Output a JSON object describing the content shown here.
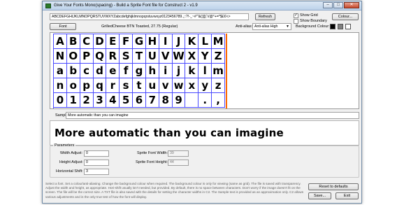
{
  "window": {
    "title": "Give Your Fonts Mono(spacing) - Build a Sprite Font file for Construct 2 - v1.9",
    "buttons": [
      "–",
      "□",
      "✕"
    ]
  },
  "toolbar": {
    "characters_value": "ABCDEFGHIJKLMNOPQRSTUVWXYZabcdefghijklmnopqrstuvwxyz0123456789.,;:?!-_~#\"'&()[]|`\\/@°+=*$£€<>",
    "refresh_label": "Refresh",
    "show_grid_label": "Show Grid",
    "show_grid_checked": "✓",
    "show_boundary_label": "Show Boundary",
    "show_boundary_checked": "",
    "colour_button_label": "Colour...",
    "font_button_label": "Font",
    "font_info": "GrilledCheese BTN Toasted, 27.75 (Regular)",
    "anti_alias_label": "Anti-alias:",
    "anti_alias_value": "Anti-alias High",
    "background_colour_label": "Background Colour:"
  },
  "glyph_rows": [
    [
      "A",
      "B",
      "C",
      "D",
      "E",
      "F",
      "G",
      "H",
      "I",
      "J",
      "K",
      "L",
      "M"
    ],
    [
      "N",
      "O",
      "P",
      "Q",
      "R",
      "S",
      "T",
      "U",
      "V",
      "W",
      "X",
      "Y",
      "Z"
    ],
    [
      "a",
      "b",
      "c",
      "d",
      "e",
      "f",
      "g",
      "h",
      "i",
      "j",
      "k",
      "l",
      "m"
    ],
    [
      "n",
      "o",
      "p",
      "q",
      "r",
      "s",
      "t",
      "u",
      "v",
      "w",
      "x",
      "y",
      "z"
    ],
    [
      "0",
      "1",
      "2",
      "3",
      "4",
      "5",
      "6",
      "7",
      "8",
      "9",
      "",
      ".",
      ","
    ]
  ],
  "sample": {
    "label": "Sample:",
    "input_value": "More automatic than you can imagine",
    "preview_text": "More automatic than you can imagine"
  },
  "params": {
    "legend": "Parameters",
    "width_adjust_label": "Width Adjust:",
    "width_adjust_value": "0",
    "height_adjust_label": "Height Adjust:",
    "height_adjust_value": "0",
    "horizontal_shift_label": "Horizontal Shift:",
    "horizontal_shift_value": "3",
    "sprite_font_width_label": "Sprite Font Width:",
    "sprite_font_width_value": "39",
    "sprite_font_height_label": "Sprite Font Height:",
    "sprite_font_height_value": "44"
  },
  "help_text": "Select a font. Set a colour/anti-aliasing. Change the background colour when required. The background colour is only for viewing (same as grid). The file is saved with transparency. Adjust the width and height, as appropriate. Hori-shift usually isn't needed, but provided. By default, there is no space between characters. Don't worry if the image doesn't fit on the screen. The file will be the correct size. A TXT file is also saved with the details for setting the character widths in C2. The Sample text is provided as an approximation only. C2 allows various adjustments and is the only true test of how the font will display.",
  "footer": {
    "reset_label": "Reset to defaults",
    "save_label": "Save...",
    "exit_label": "Exit"
  },
  "colors": {
    "grid_line": "#4a4aff",
    "boundary_line": "#ff6a00",
    "swatch_black": "#000000",
    "swatch_grey": "#808080",
    "swatch_white": "#ffffff"
  }
}
